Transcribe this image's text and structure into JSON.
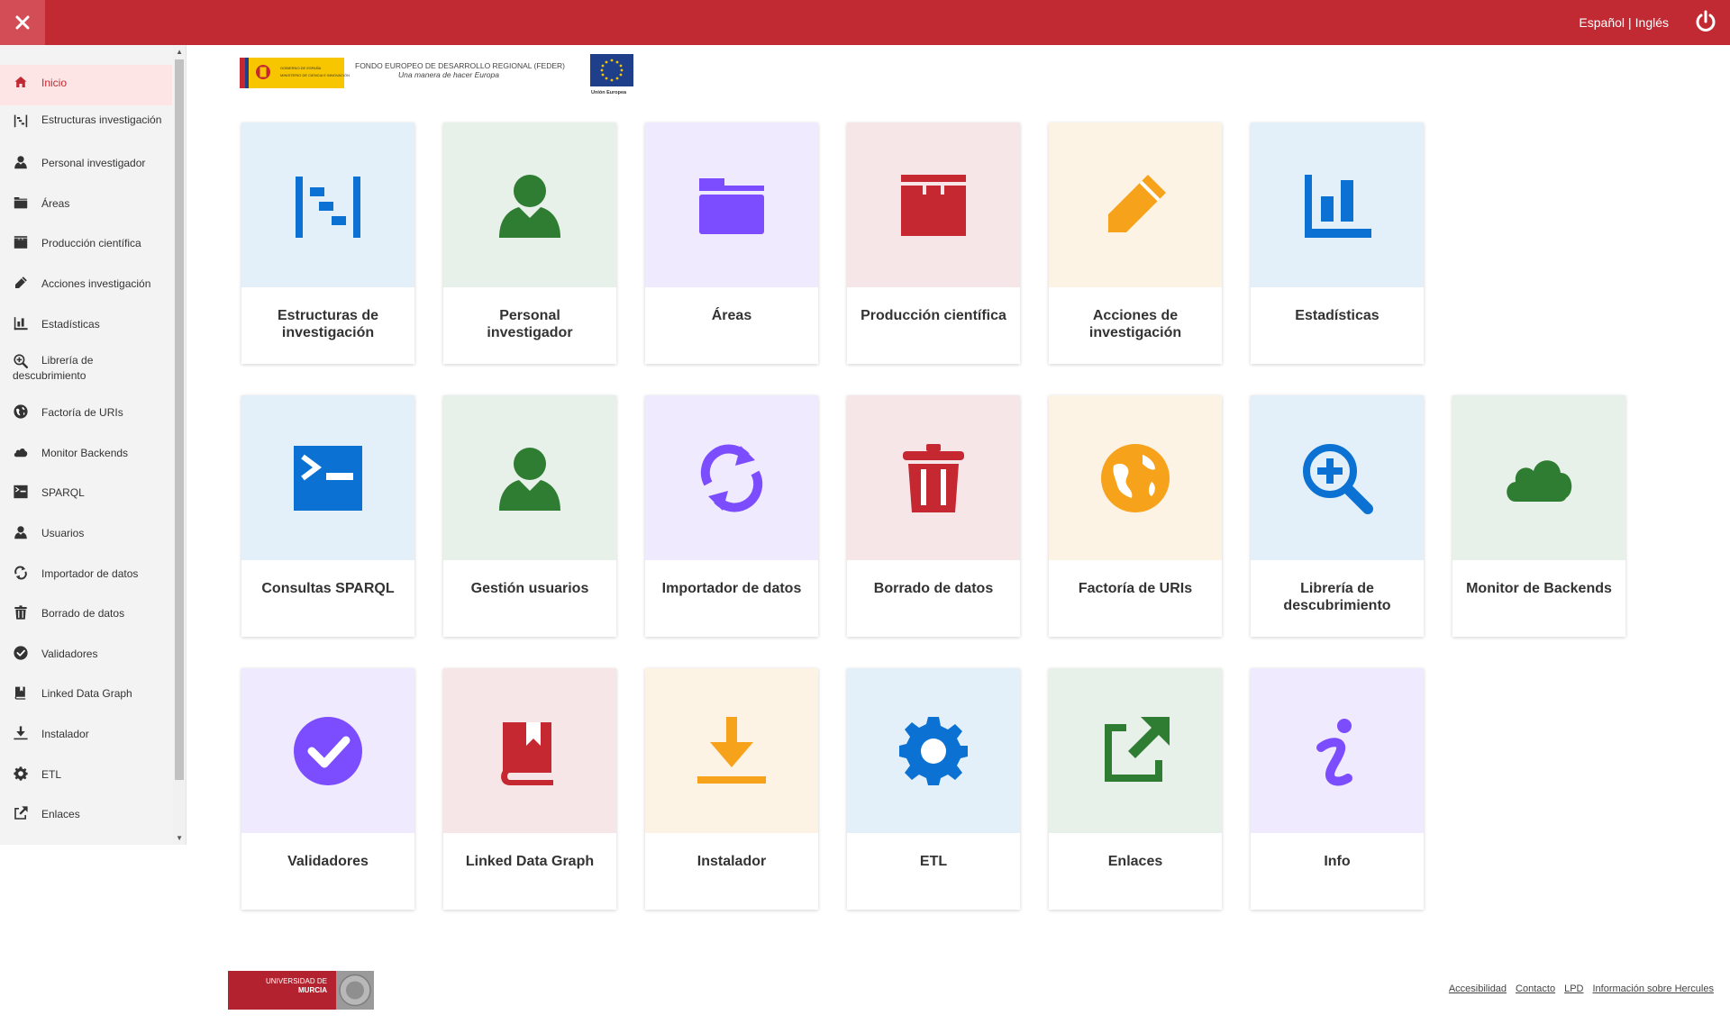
{
  "topbar": {
    "lang_es": "Español",
    "lang_sep": "|",
    "lang_en": "Inglés",
    "color": "#c12a33"
  },
  "sidebar": {
    "items": [
      {
        "label": "Inicio",
        "icon": "home-icon",
        "active": true
      },
      {
        "label": "Estructuras investigación",
        "icon": "structure-icon"
      },
      {
        "label": "Personal investigador",
        "icon": "user-icon"
      },
      {
        "label": "Áreas",
        "icon": "folder-icon"
      },
      {
        "label": "Producción científica",
        "icon": "archive-icon"
      },
      {
        "label": "Acciones investigación",
        "icon": "pencil-icon"
      },
      {
        "label": "Estadísticas",
        "icon": "chart-icon"
      },
      {
        "label": "Librería de descubrimiento",
        "icon": "zoom-plus-icon"
      },
      {
        "label": "Factoría de URIs",
        "icon": "globe-icon"
      },
      {
        "label": "Monitor Backends",
        "icon": "cloud-icon"
      },
      {
        "label": "SPARQL",
        "icon": "terminal-icon"
      },
      {
        "label": "Usuarios",
        "icon": "user-icon"
      },
      {
        "label": "Importador de datos",
        "icon": "sync-icon"
      },
      {
        "label": "Borrado de datos",
        "icon": "trash-icon"
      },
      {
        "label": "Validadores",
        "icon": "check-circle-icon"
      },
      {
        "label": "Linked Data Graph",
        "icon": "book-icon"
      },
      {
        "label": "Instalador",
        "icon": "download-icon"
      },
      {
        "label": "ETL",
        "icon": "gear-icon"
      },
      {
        "label": "Enlaces",
        "icon": "external-link-icon"
      }
    ]
  },
  "feder": {
    "line1": "FONDO EUROPEO DE DESARROLLO REGIONAL (FEDER)",
    "line2": "Una manera de hacer Europa",
    "eu": "Unión Europea",
    "gob1": "GOBIERNO DE ESPAÑA",
    "gob2": "MINISTERIO DE CIENCIA E INNOVACIÓN"
  },
  "tiles": [
    {
      "label": "Estructuras de investigación",
      "icon": "structure-icon",
      "color": "#0b72d4",
      "bg": "#e3f0fa"
    },
    {
      "label": "Personal investigador",
      "icon": "user-icon",
      "color": "#2e7d32",
      "bg": "#e8f0ea"
    },
    {
      "label": "Áreas",
      "icon": "folder-icon",
      "color": "#7c4dff",
      "bg": "#efeafd"
    },
    {
      "label": "Producción científica",
      "icon": "archive-icon",
      "color": "#c62832",
      "bg": "#f7e6e8"
    },
    {
      "label": "Acciones de investigación",
      "icon": "pencil-icon",
      "color": "#f7a21b",
      "bg": "#fdf3e5"
    },
    {
      "label": "Estadísticas",
      "icon": "chart-icon",
      "color": "#0b72d4",
      "bg": "#e3f0fa"
    },
    {
      "label": "Consultas SPARQL",
      "icon": "terminal-icon",
      "color": "#0b72d4",
      "bg": "#e3f0fa"
    },
    {
      "label": "Gestión usuarios",
      "icon": "user-icon",
      "color": "#2e7d32",
      "bg": "#e8f0ea"
    },
    {
      "label": "Importador de datos",
      "icon": "sync-icon",
      "color": "#7c4dff",
      "bg": "#efeafd"
    },
    {
      "label": "Borrado de datos",
      "icon": "trash-icon",
      "color": "#c62832",
      "bg": "#f7e6e8"
    },
    {
      "label": "Factoría de URIs",
      "icon": "globe-icon",
      "color": "#f7a21b",
      "bg": "#fdf3e5"
    },
    {
      "label": "Librería de descubrimiento",
      "icon": "zoom-plus-icon",
      "color": "#0b72d4",
      "bg": "#e3f0fa"
    },
    {
      "label": "Monitor de Backends",
      "icon": "cloud-icon",
      "color": "#2e7d32",
      "bg": "#e8f0ea"
    },
    {
      "label": "Validadores",
      "icon": "check-circle-icon",
      "color": "#7c4dff",
      "bg": "#efeafd"
    },
    {
      "label": "Linked Data Graph",
      "icon": "book-icon",
      "color": "#c62832",
      "bg": "#f7e6e8"
    },
    {
      "label": "Instalador",
      "icon": "download-icon",
      "color": "#f7a21b",
      "bg": "#fdf3e5"
    },
    {
      "label": "ETL",
      "icon": "gear-icon",
      "color": "#0b72d4",
      "bg": "#e3f0fa"
    },
    {
      "label": "Enlaces",
      "icon": "external-link-icon",
      "color": "#2e7d32",
      "bg": "#e8f0ea"
    },
    {
      "label": "Info",
      "icon": "info-icon",
      "color": "#7c4dff",
      "bg": "#efeafd"
    }
  ],
  "footer": {
    "university_line1": "UNIVERSIDAD DE",
    "university_line2": "MURCIA",
    "links": [
      "Accesibilidad",
      "Contacto",
      "LPD",
      "Información sobre Hercules"
    ]
  }
}
